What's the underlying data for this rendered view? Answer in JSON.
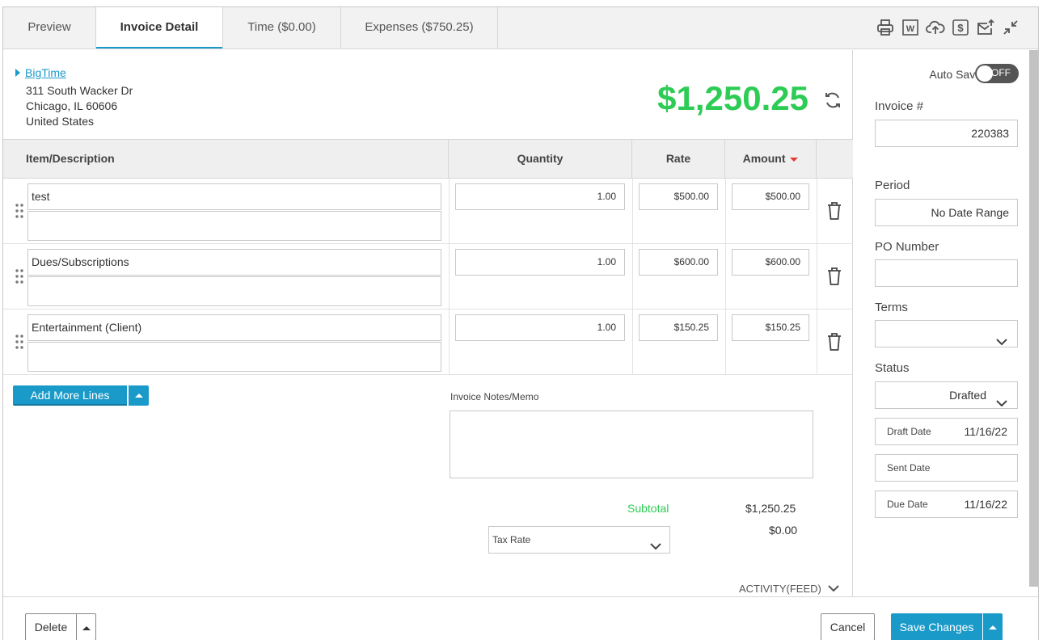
{
  "tabs": [
    {
      "label": "Preview",
      "active": false
    },
    {
      "label": "Invoice Detail",
      "active": true
    },
    {
      "label": "Time ($0.00)",
      "active": false
    },
    {
      "label": "Expenses ($750.25)",
      "active": false
    }
  ],
  "toolbar_icons": [
    "print-icon",
    "word-export-icon",
    "cloud-upload-icon",
    "dollar-icon",
    "email-send-icon",
    "collapse-icon"
  ],
  "client": {
    "name": "BigTime",
    "address_line1": "311 South Wacker Dr",
    "address_line2": "Chicago, IL 60606",
    "address_line3": "United States"
  },
  "invoice_total": "$1,250.25",
  "table": {
    "headers": {
      "item": "Item/Description",
      "quantity": "Quantity",
      "rate": "Rate",
      "amount": "Amount"
    },
    "rows": [
      {
        "description": "test",
        "notes": "",
        "quantity": "1.00",
        "rate": "$500.00",
        "amount": "$500.00"
      },
      {
        "description": "Dues/Subscriptions",
        "notes": "",
        "quantity": "1.00",
        "rate": "$600.00",
        "amount": "$600.00"
      },
      {
        "description": "Entertainment (Client)",
        "notes": "",
        "quantity": "1.00",
        "rate": "$150.25",
        "amount": "$150.25"
      }
    ]
  },
  "add_more_lines_label": "Add More Lines",
  "notes": {
    "label": "Invoice Notes/Memo",
    "value": ""
  },
  "totals": {
    "subtotal_label": "Subtotal",
    "subtotal_value": "$1,250.25",
    "tax_value": "$0.00",
    "tax_rate_placeholder": "Tax Rate"
  },
  "activity_label": "ACTIVITY(FEED)",
  "side": {
    "auto_save_label": "Auto Save",
    "auto_save_state": "OFF",
    "invoice_number_label": "Invoice #",
    "invoice_number": "220383",
    "period_label": "Period",
    "period_value": "No Date Range",
    "po_number_label": "PO Number",
    "po_number_value": "",
    "terms_label": "Terms",
    "terms_value": "",
    "status_label": "Status",
    "status_value": "Drafted",
    "draft_date_label": "Draft Date",
    "draft_date": "11/16/22",
    "sent_date_label": "Sent Date",
    "sent_date": "",
    "due_date_label": "Due Date",
    "due_date": "11/16/22"
  },
  "footer": {
    "delete_label": "Delete",
    "cancel_label": "Cancel",
    "save_label": "Save Changes"
  },
  "colors": {
    "accent": "#1a9ac9",
    "total_green": "#2ecc55",
    "sort_arrow": "#e53935"
  }
}
